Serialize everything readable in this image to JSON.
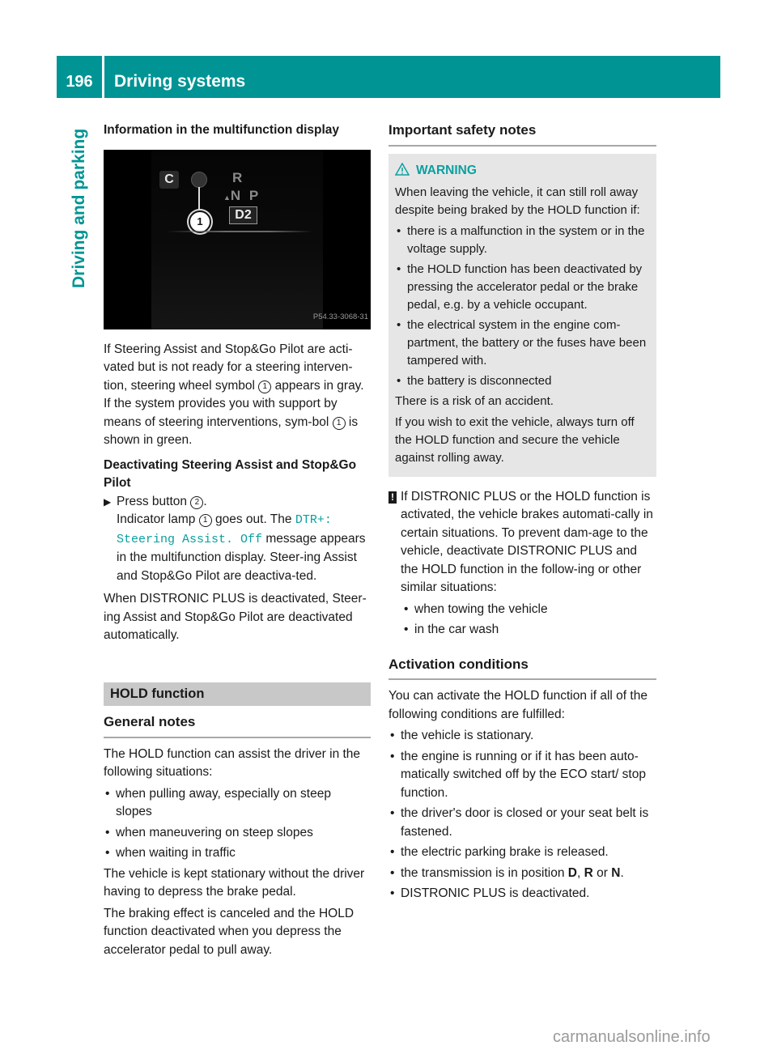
{
  "header": {
    "page_number": "196",
    "title": "Driving systems",
    "color": "#009494"
  },
  "side_tab": {
    "label": "Driving and parking"
  },
  "left": {
    "heading_info": "Information in the multifunction display",
    "figure": {
      "icons": [
        "c-icon",
        "steering-wheel-icon"
      ],
      "gear_r": "R",
      "gear_np": "N P",
      "gear_current": "D2",
      "label_c": "C",
      "callout": "1",
      "code": "P54.33-3068-31"
    },
    "para1_a": "If Steering Assist and Stop&Go Pilot are acti-vated but is not ready for a steering interven-tion, steering wheel symbol",
    "para1_b": "appears in gray. If the system provides you with support by means of steering interventions, sym-bol",
    "para1_c": "is shown in green.",
    "callout_1": "1",
    "callout_2": "2",
    "heading_deactivating": "Deactivating Steering Assist and Stop&Go Pilot",
    "step_a": "Press button",
    "step_a_end": ".",
    "step_b": "Indicator lamp",
    "step_c": "goes out. The",
    "display_msg": "DTR+: Steering Assist. Off",
    "step_d": "message appears in the multifunction display. Steer-ing Assist and Stop&Go Pilot are deactiva-ted.",
    "para2": "When DISTRONIC PLUS is deactivated, Steer-ing Assist and Stop&Go Pilot are deactivated automatically.",
    "section_title": "HOLD function",
    "heading_general": "General notes",
    "para3": "The HOLD function can assist the driver in the following situations:",
    "situations": [
      "when pulling away, especially on steep slopes",
      "when maneuvering on steep slopes",
      "when waiting in traffic"
    ],
    "para4": "The vehicle is kept stationary without the driver having to depress the brake pedal.",
    "para5": "The braking effect is canceled and the HOLD function deactivated when you depress the accelerator pedal to pull away."
  },
  "right": {
    "heading_safety": "Important safety notes",
    "warning": {
      "title": "WARNING",
      "intro": "When leaving the vehicle, it can still roll away despite being braked by the HOLD function if:",
      "items": [
        "there is a malfunction in the system or in the voltage supply.",
        "the HOLD function has been deactivated by pressing the accelerator pedal or the brake pedal, e.g. by a vehicle occupant.",
        "the electrical system in the engine com-partment, the battery or the fuses have been tampered with.",
        "the battery is disconnected"
      ],
      "risk": "There is a risk of an accident.",
      "advice": "If you wish to exit the vehicle, always turn off the HOLD function and secure the vehicle against rolling away."
    },
    "note": {
      "icon": "!",
      "text": "If DISTRONIC PLUS or the HOLD function is activated, the vehicle brakes automati-cally in certain situations. To prevent dam-age to the vehicle, deactivate DISTRONIC PLUS and the HOLD function in the follow-ing or other similar situations:",
      "items": [
        "when towing the vehicle",
        "in the car wash"
      ]
    },
    "heading_activation": "Activation conditions",
    "activation_intro": "You can activate the HOLD function if all of the following conditions are fulfilled:",
    "conditions": [
      "the vehicle is stationary.",
      "the engine is running or if it has been auto-matically switched off by the ECO start/ stop function.",
      "the driver's door is closed or your seat belt is fastened.",
      "the electric parking brake is released."
    ],
    "transmission_a": "the transmission is in position",
    "pos_d": "D",
    "comma": ",",
    "pos_r": "R",
    "or": "or",
    "pos_n": "N",
    "period": ".",
    "condition_last": "DISTRONIC PLUS is deactivated."
  },
  "watermark": "carmanualsonline.info"
}
